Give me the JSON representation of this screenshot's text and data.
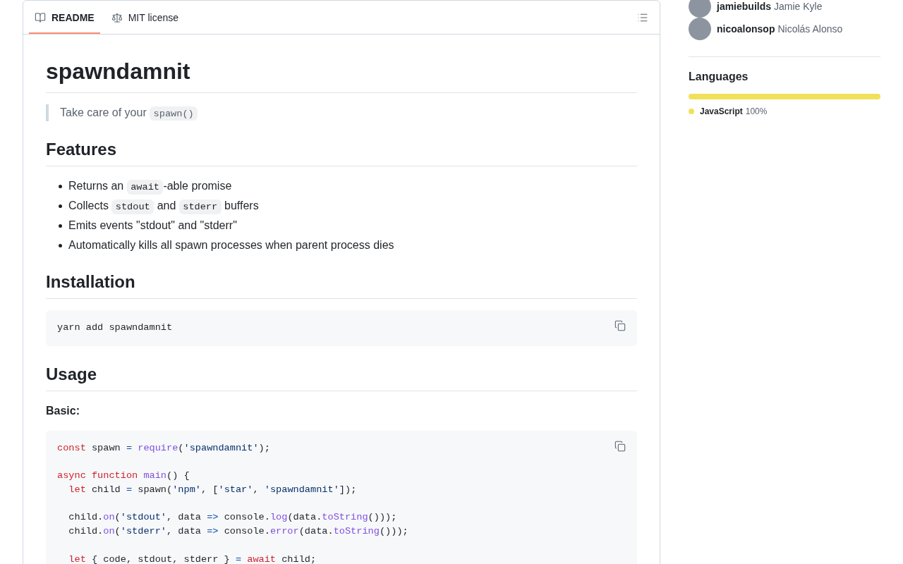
{
  "tabs": [
    {
      "label": "README",
      "selected": true
    },
    {
      "label": "MIT license",
      "selected": false
    }
  ],
  "readme": {
    "title": "spawndamnit",
    "blockquote": [
      {
        "kind": "text",
        "text": "Take care of your "
      },
      {
        "kind": "code",
        "text": "spawn()"
      }
    ],
    "sections": [
      {
        "heading": "Features",
        "blocks": [
          {
            "kind": "list",
            "items": [
              [
                {
                  "kind": "text",
                  "text": "Returns an "
                },
                {
                  "kind": "code",
                  "text": "await"
                },
                {
                  "kind": "text",
                  "text": "-able promise"
                }
              ],
              [
                {
                  "kind": "text",
                  "text": "Collects "
                },
                {
                  "kind": "code",
                  "text": "stdout"
                },
                {
                  "kind": "text",
                  "text": " and "
                },
                {
                  "kind": "code",
                  "text": "stderr"
                },
                {
                  "kind": "text",
                  "text": " buffers"
                }
              ],
              [
                {
                  "kind": "text",
                  "text": "Emits events \"stdout\" and \"stderr\""
                }
              ],
              [
                {
                  "kind": "text",
                  "text": "Automatically kills all spawn processes when parent process dies"
                }
              ]
            ]
          }
        ]
      },
      {
        "heading": "Installation",
        "blocks": [
          {
            "kind": "code",
            "groups": [
              [
                [
                  {
                    "kind": "plain",
                    "text": "yarn add spawndamnit"
                  }
                ]
              ]
            ]
          }
        ]
      },
      {
        "heading": "Usage",
        "blocks": [
          {
            "kind": "subheading",
            "text": "Basic:"
          },
          {
            "kind": "code",
            "groups": [
              [
                [
                  {
                    "kind": "keyword",
                    "text": "const"
                  },
                  {
                    "kind": "plain",
                    "text": " spawn "
                  },
                  {
                    "kind": "operator",
                    "text": "= "
                  },
                  {
                    "kind": "function",
                    "text": "require"
                  },
                  {
                    "kind": "plain",
                    "text": "("
                  },
                  {
                    "kind": "string",
                    "text": "'spawndamnit'"
                  },
                  {
                    "kind": "plain",
                    "text": ");"
                  }
                ]
              ],
              [
                [
                  {
                    "kind": "keyword",
                    "text": "async function"
                  },
                  {
                    "kind": "function",
                    "text": " main"
                  },
                  {
                    "kind": "plain",
                    "text": "() {"
                  }
                ],
                [
                  {
                    "kind": "keyword",
                    "text": "  let"
                  },
                  {
                    "kind": "plain",
                    "text": " child "
                  },
                  {
                    "kind": "operator",
                    "text": "="
                  },
                  {
                    "kind": "plain",
                    "text": " spawn("
                  },
                  {
                    "kind": "string",
                    "text": "'npm'"
                  },
                  {
                    "kind": "plain",
                    "text": ", ["
                  },
                  {
                    "kind": "string",
                    "text": "'star'"
                  },
                  {
                    "kind": "plain",
                    "text": ", "
                  },
                  {
                    "kind": "string",
                    "text": "'spawndamnit'"
                  },
                  {
                    "kind": "plain",
                    "text": "]);"
                  }
                ]
              ],
              [
                [
                  {
                    "kind": "plain",
                    "text": "  child."
                  },
                  {
                    "kind": "function",
                    "text": "on"
                  },
                  {
                    "kind": "plain",
                    "text": "("
                  },
                  {
                    "kind": "string",
                    "text": "'stdout'"
                  },
                  {
                    "kind": "plain",
                    "text": ", data "
                  },
                  {
                    "kind": "operator",
                    "text": "=>"
                  },
                  {
                    "kind": "plain",
                    "text": " console."
                  },
                  {
                    "kind": "function",
                    "text": "log"
                  },
                  {
                    "kind": "plain",
                    "text": "(data."
                  },
                  {
                    "kind": "function",
                    "text": "toString"
                  },
                  {
                    "kind": "plain",
                    "text": "()));"
                  }
                ],
                [
                  {
                    "kind": "plain",
                    "text": "  child."
                  },
                  {
                    "kind": "function",
                    "text": "on"
                  },
                  {
                    "kind": "plain",
                    "text": "("
                  },
                  {
                    "kind": "string",
                    "text": "'stderr'"
                  },
                  {
                    "kind": "plain",
                    "text": ", data "
                  },
                  {
                    "kind": "operator",
                    "text": "=>"
                  },
                  {
                    "kind": "plain",
                    "text": " console."
                  },
                  {
                    "kind": "function",
                    "text": "error"
                  },
                  {
                    "kind": "plain",
                    "text": "(data."
                  },
                  {
                    "kind": "function",
                    "text": "toString"
                  },
                  {
                    "kind": "plain",
                    "text": "()));"
                  }
                ]
              ],
              [
                [
                  {
                    "kind": "keyword",
                    "text": "  let"
                  },
                  {
                    "kind": "plain",
                    "text": " { code, stdout, stderr } "
                  },
                  {
                    "kind": "operator",
                    "text": "= "
                  },
                  {
                    "kind": "keyword",
                    "text": "await"
                  },
                  {
                    "kind": "plain",
                    "text": " child;"
                  }
                ]
              ]
            ]
          }
        ]
      }
    ]
  },
  "sidebar": {
    "contributors": [
      {
        "login": "jamiebuilds",
        "name": "Jamie Kyle"
      },
      {
        "login": "nicoalonsop",
        "name": "Nicolás Alonso"
      }
    ],
    "languages": {
      "heading": "Languages",
      "items": [
        {
          "name": "JavaScript",
          "percent": "100%",
          "color": "#f1e05a",
          "level": 1
        }
      ]
    }
  }
}
